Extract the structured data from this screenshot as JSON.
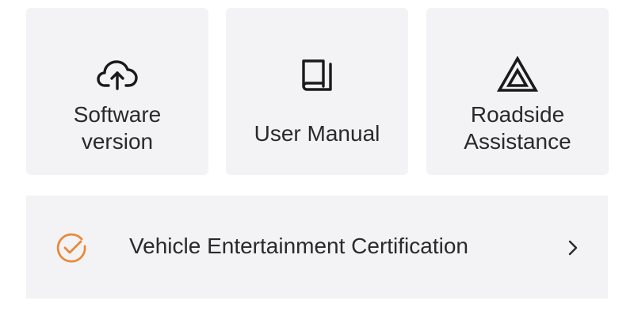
{
  "tiles": [
    {
      "id": "software",
      "label": "Software\nversion",
      "icon": "cloud-upload-icon"
    },
    {
      "id": "manual",
      "label": "User Manual",
      "icon": "book-icon"
    },
    {
      "id": "roadside",
      "label": "Roadside\nAssistance",
      "icon": "warning-triangle-icon"
    }
  ],
  "certification": {
    "label": "Vehicle Entertainment Certification",
    "icon": "check-circle-icon",
    "accent": "#e8893a",
    "chevron": "chevron-right-icon"
  },
  "colors": {
    "tile_bg": "#f3f3f5",
    "text": "#2a2a2e",
    "icon": "#1a1a1a"
  }
}
